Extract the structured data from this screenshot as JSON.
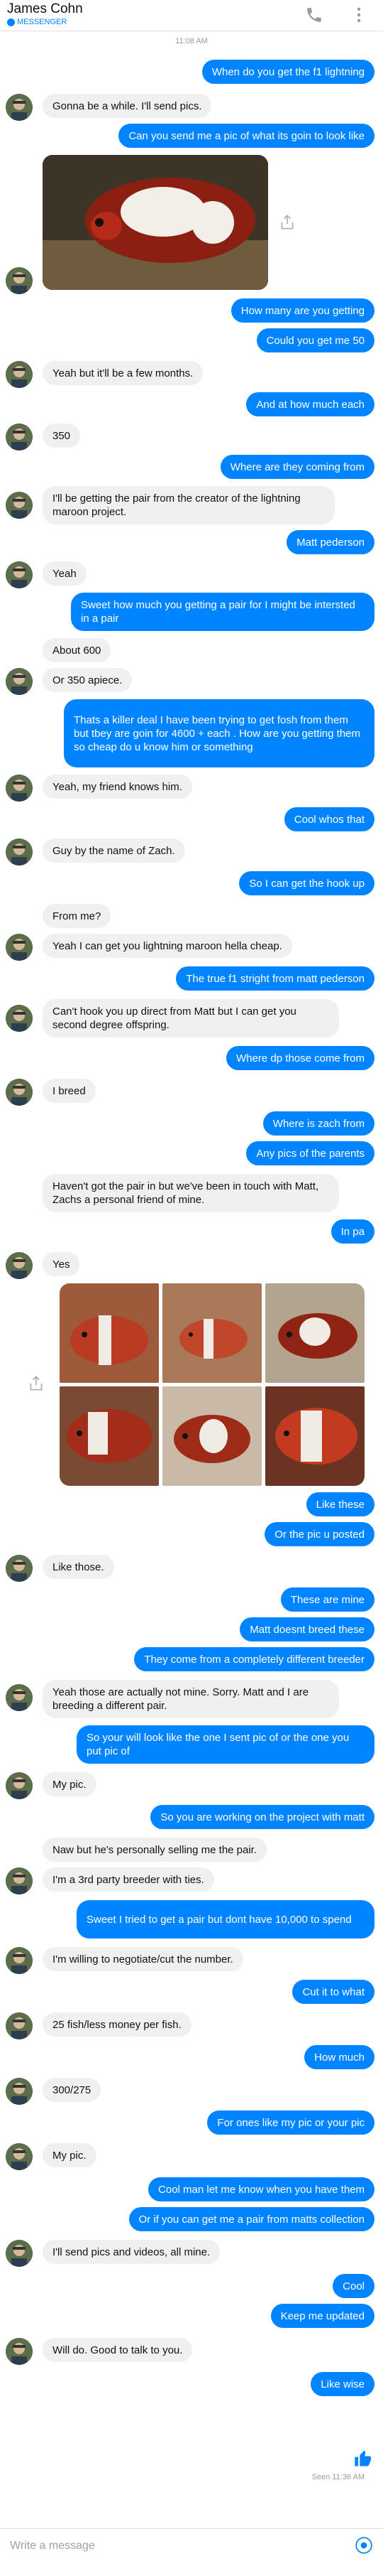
{
  "header": {
    "contact_name": "James Cohn",
    "subtitle": "MESSENGER"
  },
  "timestamp_top": "11:08 AM",
  "messages": [
    {
      "dir": "out",
      "text": "When do you get the f1 lightning"
    },
    {
      "dir": "in",
      "text": "Gonna be a while. I'll send pics."
    },
    {
      "dir": "out",
      "text": "Can you send me a pic of what its goin to look like"
    },
    {
      "dir": "out",
      "text": "How many are you getting"
    },
    {
      "dir": "out",
      "text": "Could you get me 50"
    },
    {
      "dir": "in",
      "text": "Yeah but it'll be a few months."
    },
    {
      "dir": "out",
      "text": "And at how much each"
    },
    {
      "dir": "in",
      "text": "350"
    },
    {
      "dir": "out",
      "text": "Where are they coming from"
    },
    {
      "dir": "in",
      "text": "I'll be getting the pair from the creator of the lightning maroon project."
    },
    {
      "dir": "out",
      "text": "Matt pederson"
    },
    {
      "dir": "in",
      "text": "Yeah"
    },
    {
      "dir": "out",
      "text": "Sweet how much you getting a pair for I might be intersted in a pair"
    },
    {
      "dir": "in",
      "text": "About 600"
    },
    {
      "dir": "in",
      "text": "Or 350 apiece."
    },
    {
      "dir": "out",
      "text": "Thats a killer deal  I have been trying to get fosh from them but tbey are goin for 4600 + each . How are you getting them so cheap do u know him or something"
    },
    {
      "dir": "in",
      "text": "Yeah, my friend knows him."
    },
    {
      "dir": "out",
      "text": "Cool whos that"
    },
    {
      "dir": "in",
      "text": "Guy by the name of Zach."
    },
    {
      "dir": "out",
      "text": "So I can get the hook up"
    },
    {
      "dir": "in",
      "text": "From me?"
    },
    {
      "dir": "in",
      "text": "Yeah I can get you lightning maroon hella cheap."
    },
    {
      "dir": "out",
      "text": "The true f1 stright from matt pederson"
    },
    {
      "dir": "in",
      "text": "Can't hook you up direct from Matt but I can get you second degree offspring."
    },
    {
      "dir": "out",
      "text": "Where dp those come from"
    },
    {
      "dir": "in",
      "text": "I breed"
    },
    {
      "dir": "out",
      "text": "Where is zach from"
    },
    {
      "dir": "out",
      "text": "Any pics of the parents"
    },
    {
      "dir": "in",
      "text": "Haven't got the pair in but we've been in touch with Matt, Zachs a personal friend of mine."
    },
    {
      "dir": "out",
      "text": "In pa"
    },
    {
      "dir": "in",
      "text": "Yes"
    },
    {
      "dir": "out",
      "text": "Like these"
    },
    {
      "dir": "out",
      "text": "Or the pic u posted"
    },
    {
      "dir": "in",
      "text": "Like those."
    },
    {
      "dir": "out",
      "text": "These are mine"
    },
    {
      "dir": "out",
      "text": "Matt doesnt breed these"
    },
    {
      "dir": "out",
      "text": "They come from a completely different breeder"
    },
    {
      "dir": "in",
      "text": "Yeah those are actually not mine. Sorry. Matt and I are breeding a different pair."
    },
    {
      "dir": "out",
      "text": "So your will look like the one I sent pic of or the one you put pic of"
    },
    {
      "dir": "in",
      "text": "My pic."
    },
    {
      "dir": "out",
      "text": "So you are working on the project with matt"
    },
    {
      "dir": "in",
      "text": "Naw but he's personally selling me the pair."
    },
    {
      "dir": "in",
      "text": "I'm a 3rd party breeder with ties."
    },
    {
      "dir": "out",
      "text": "Sweet I tried to get a pair but dont have 10,000 to spend"
    },
    {
      "dir": "in",
      "text": "I'm willing to negotiate/cut the number."
    },
    {
      "dir": "out",
      "text": "Cut it to what"
    },
    {
      "dir": "in",
      "text": "25 fish/less money per fish."
    },
    {
      "dir": "out",
      "text": "How much"
    },
    {
      "dir": "in",
      "text": "300/275"
    },
    {
      "dir": "out",
      "text": "For ones like my pic or your pic"
    },
    {
      "dir": "in",
      "text": "My pic."
    },
    {
      "dir": "out",
      "text": "Cool man let me know when you have them"
    },
    {
      "dir": "out",
      "text": "Or if you can get me a pair from matts collection"
    },
    {
      "dir": "in",
      "text": "I'll send pics and videos, all mine."
    },
    {
      "dir": "out",
      "text": "Cool"
    },
    {
      "dir": "out",
      "text": "Keep me updated"
    },
    {
      "dir": "in",
      "text": "Will do. Good to talk to you."
    },
    {
      "dir": "out",
      "text": "Like wise"
    }
  ],
  "seen_text": "Seen 11:36 AM",
  "composer": {
    "placeholder": "Write a message"
  },
  "colors": {
    "outgoing": "#0084ff",
    "incoming": "#f1f0f0",
    "accent": "#0084ff"
  },
  "icons": {
    "call": "phone-icon",
    "menu": "more-vertical-icon",
    "share": "share-icon",
    "like": "thumbs-up-icon",
    "camera": "camera-icon"
  }
}
